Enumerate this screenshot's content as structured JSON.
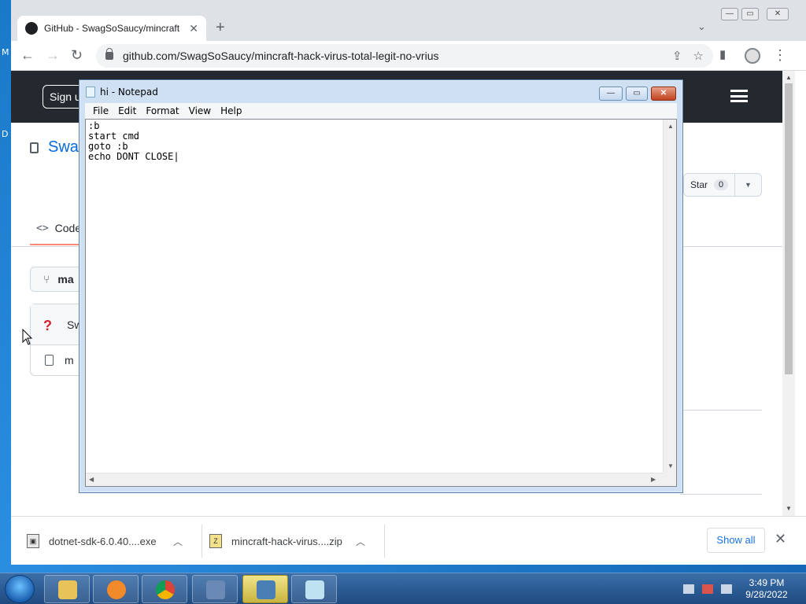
{
  "desktop": {
    "labels": [
      "M",
      "D"
    ]
  },
  "browser": {
    "tab_title": "GitHub - SwagSoSaucy/mincraft",
    "url": "github.com/SwagSoSaucy/mincraft-hack-virus-total-legit-no-vrius",
    "colors": {
      "tabstrip": "#dee1e6",
      "accent": "#1a73e8"
    }
  },
  "github": {
    "signup_label": "Sign u",
    "repo_name": "Swag",
    "star_label": "Star",
    "star_count": "0",
    "code_tab_label": "Code",
    "branch_label": "ma",
    "commit_author": "Sw",
    "file_name": "m",
    "colors": {
      "header": "#24292f",
      "link": "#0969da",
      "tab_underline": "#fd8c73"
    }
  },
  "notepad": {
    "title": "hi - Notepad",
    "menu": [
      "File",
      "Edit",
      "Format",
      "View",
      "Help"
    ],
    "content": ":b\nstart cmd\ngoto :b\necho DONT CLOSE|"
  },
  "downloads": {
    "items": [
      {
        "name": "dotnet-sdk-6.0.40....exe",
        "icon": "installer-icon"
      },
      {
        "name": "mincraft-hack-virus....zip",
        "icon": "zip-icon"
      }
    ],
    "show_all_label": "Show all"
  },
  "taskbar": {
    "apps": [
      "explorer-icon",
      "media-player-icon",
      "chrome-icon",
      "control-panel-icon",
      "setup-icon",
      "notepad-icon"
    ],
    "time": "3:49 PM",
    "date": "9/28/2022"
  }
}
